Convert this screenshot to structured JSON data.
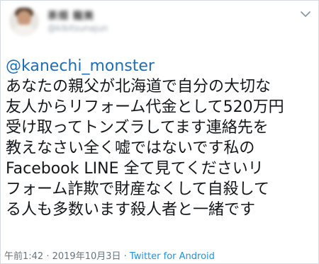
{
  "header": {
    "display_name": "茶畑 龍美",
    "handle": "@kibitsunajun",
    "avatar_icon": "user-avatar",
    "menu_icon": "chevron-down-icon"
  },
  "tweet": {
    "mention": "@kanechi_monster",
    "lines": [
      "あなたの親父が北海道で自分の大切な",
      "友人からリフォーム代金として520万円",
      "受け取ってトンズラしてます連絡先を",
      "教えなさい全く嘘ではないです私の",
      "Facebook LINE 全て見てくださいリ",
      "フォーム詐欺で財産なくして自殺して",
      "る人も多数います殺人者と一緒です"
    ]
  },
  "meta": {
    "time": "午前1:42",
    "separator1": " · ",
    "date": "2019年10月3日",
    "separator2": " · ",
    "source": "Twitter for Android"
  },
  "colors": {
    "link": "#1b6fb8",
    "source_link": "#1b95e0",
    "text": "#14171a",
    "meta_text": "#66757f",
    "border": "#d6dbe0"
  }
}
